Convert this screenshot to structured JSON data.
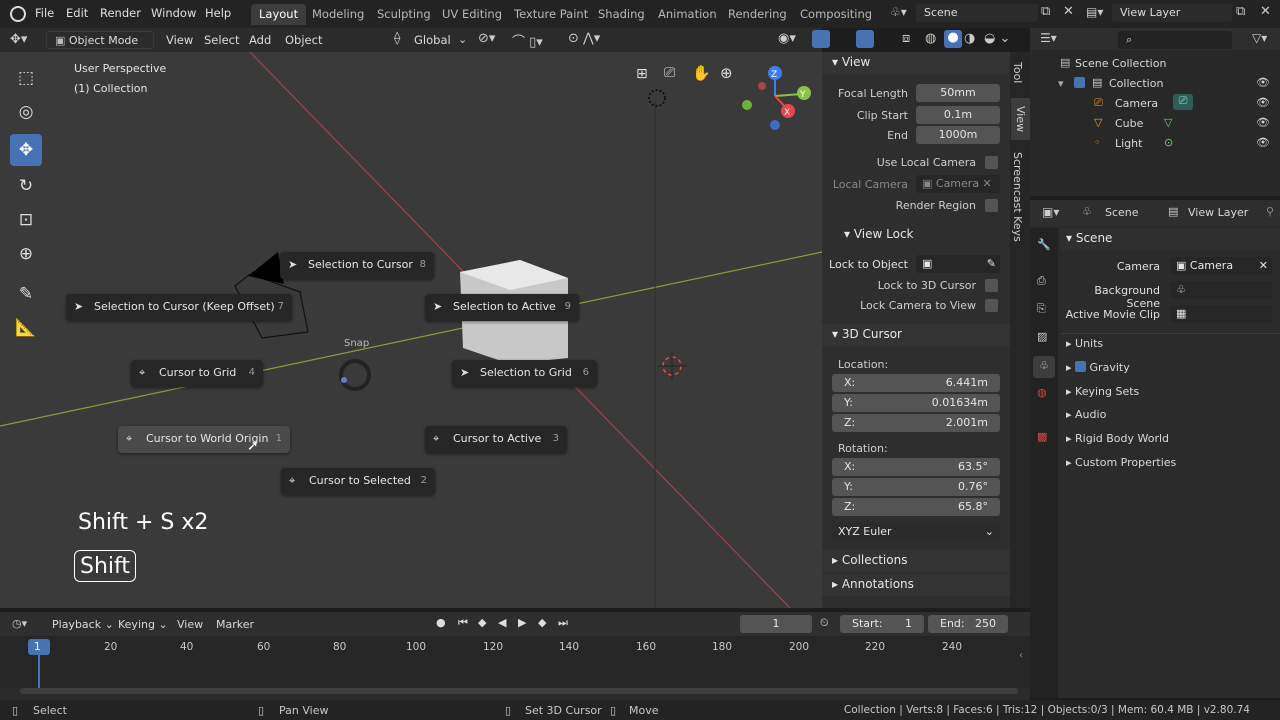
{
  "topbar": {
    "menus": [
      "File",
      "Edit",
      "Render",
      "Window",
      "Help"
    ],
    "workspaces": [
      "Layout",
      "Modeling",
      "Sculpting",
      "UV Editing",
      "Texture Paint",
      "Shading",
      "Animation",
      "Rendering",
      "Compositing"
    ],
    "active_workspace": "Layout",
    "scene": "Scene",
    "view_layer": "View Layer"
  },
  "viewport_header": {
    "mode": "Object Mode",
    "menus": [
      "View",
      "Select",
      "Add",
      "Object"
    ],
    "orientation": "Global"
  },
  "viewport": {
    "perspective": "User Perspective",
    "collection": "(1) Collection",
    "snap_label": "Snap",
    "pie_items": [
      {
        "label": "Selection to Cursor",
        "num": "8",
        "icon": "cursor-arrow-icon"
      },
      {
        "label": "Selection to Cursor (Keep Offset)",
        "num": "7",
        "icon": "cursor-arrow-icon"
      },
      {
        "label": "Selection to Active",
        "num": "9",
        "icon": "cursor-arrow-icon"
      },
      {
        "label": "Cursor to Grid",
        "num": "4",
        "icon": "crosshair-icon"
      },
      {
        "label": "Selection to Grid",
        "num": "6",
        "icon": "cursor-arrow-icon"
      },
      {
        "label": "Cursor to World Origin",
        "num": "1",
        "icon": "crosshair-icon"
      },
      {
        "label": "Cursor to Active",
        "num": "3",
        "icon": "crosshair-icon"
      },
      {
        "label": "Cursor to Selected",
        "num": "2",
        "icon": "crosshair-icon"
      }
    ],
    "keys_overlay": "Shift + S x2",
    "key_badge": "Shift"
  },
  "npanel": {
    "tabs": [
      "Tool",
      "View",
      "Screencast Keys"
    ],
    "view": {
      "title": "View",
      "focal_length_label": "Focal Length",
      "focal_length": "50mm",
      "clip_start_label": "Clip Start",
      "clip_start": "0.1m",
      "end_label": "End",
      "end": "1000m",
      "use_local_camera": "Use Local Camera",
      "local_camera_label": "Local Camera",
      "local_camera_value": "Camera",
      "render_region": "Render Region"
    },
    "view_lock": {
      "title": "View Lock",
      "lock_to_object": "Lock to Object",
      "lock_to_3d_cursor": "Lock to 3D Cursor",
      "lock_camera_to_view": "Lock Camera to View"
    },
    "cursor": {
      "title": "3D Cursor",
      "location_label": "Location:",
      "x": "6.441m",
      "y": "0.01634m",
      "z": "2.001m",
      "rotation_label": "Rotation:",
      "rx": "63.5°",
      "ry": "0.76°",
      "rz": "65.8°",
      "mode": "XYZ Euler"
    },
    "collections": "Collections",
    "annotations": "Annotations"
  },
  "outliner": {
    "root": "Scene Collection",
    "collection": "Collection",
    "items": [
      "Camera",
      "Cube",
      "Light"
    ]
  },
  "properties": {
    "scene_tab": "Scene",
    "view_layer_tab": "View Layer",
    "panel_title": "Scene",
    "camera_label": "Camera",
    "camera_value": "Camera",
    "background_scene": "Background Scene",
    "active_movie_clip": "Active Movie Clip",
    "sections": [
      "Units",
      "Gravity",
      "Keying Sets",
      "Audio",
      "Rigid Body World",
      "Custom Properties"
    ]
  },
  "timeline": {
    "menus": [
      "Playback",
      "Keying",
      "View",
      "Marker"
    ],
    "current_frame": "1",
    "start_label": "Start:",
    "start": "1",
    "end_label": "End:",
    "end": "250",
    "ticks": [
      "1",
      "20",
      "40",
      "60",
      "80",
      "100",
      "120",
      "140",
      "160",
      "180",
      "200",
      "220",
      "240"
    ]
  },
  "statusbar": {
    "select": "Select",
    "pan": "Pan View",
    "set_cursor": "Set 3D Cursor",
    "move": "Move",
    "stats": "Collection | Verts:8 | Faces:6 | Tris:12 | Objects:0/3 | Mem: 60.4 MB | v2.80.74"
  },
  "colors": {
    "accent": "#4772b3",
    "x_axis": "#e8444a",
    "y_axis": "#8bc34a",
    "z_axis": "#3d7ff0"
  }
}
